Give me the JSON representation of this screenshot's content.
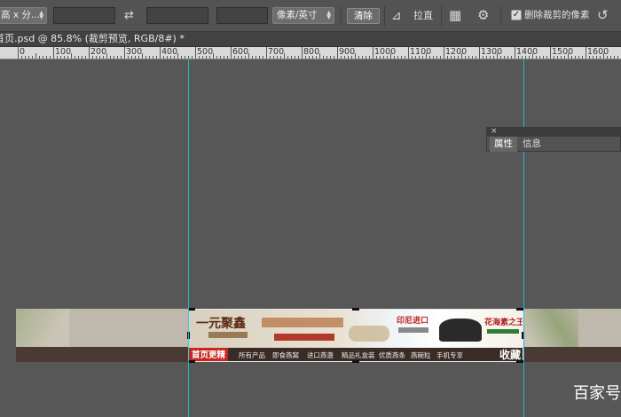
{
  "options": {
    "ratio_select": "高 x 分...",
    "units_select": "像素/英寸",
    "clear_button": "清除",
    "straighten_label": "拉直",
    "delete_cropped_label": "删除裁剪的像素"
  },
  "document": {
    "tab_title": "首页.psd @ 85.8% (裁剪预览, RGB/8#) *"
  },
  "ruler": {
    "labels": [
      "0",
      "100",
      "200",
      "300",
      "400",
      "500",
      "600",
      "700",
      "800",
      "900",
      "1000",
      "1100",
      "1200",
      "1300",
      "1400",
      "1500",
      "1600"
    ]
  },
  "panel": {
    "close": "×",
    "tabs": [
      "属性",
      "信息"
    ]
  },
  "banner": {
    "logo_text": "一元聚鑫",
    "import_text": "印尼进口",
    "king_text": "花海素之王",
    "nav_home": "首页更精彩",
    "nav_items": [
      "所有产品",
      "即食燕窝",
      "进口燕盏",
      "精品礼盒装",
      "优质燕条",
      "燕碗粒",
      "手机专享"
    ],
    "nav_right": "收藏"
  },
  "watermark": "百家号",
  "icons": {
    "swap": "swap-icon",
    "straighten": "straighten-icon",
    "grid": "grid-overlay-icon",
    "gear": "gear-icon",
    "reset": "reset-icon"
  }
}
